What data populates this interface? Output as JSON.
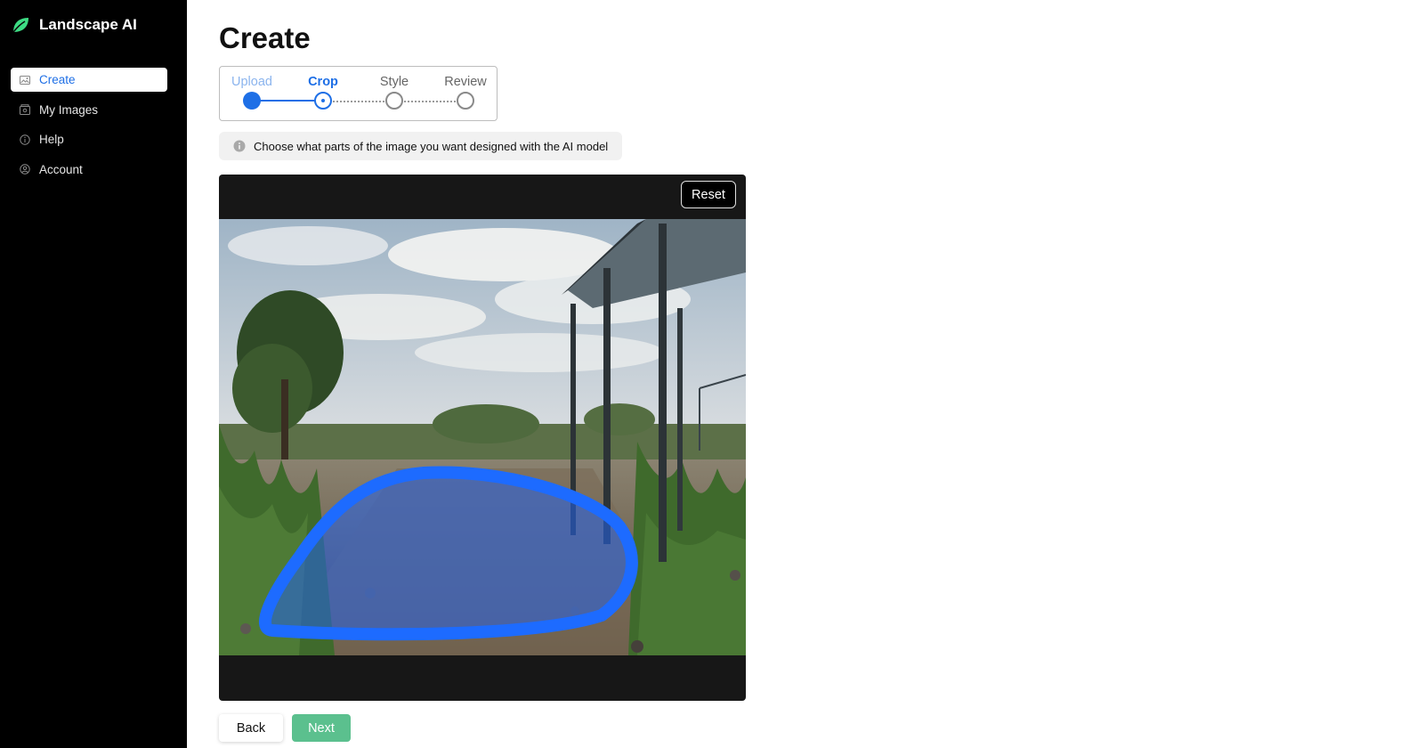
{
  "app": {
    "name": "Landscape AI",
    "accent": "#1e6fe6",
    "success": "#5bc08e"
  },
  "sidebar": {
    "items": [
      {
        "label": "Create",
        "icon": "image-icon",
        "active": true
      },
      {
        "label": "My Images",
        "icon": "gallery-icon",
        "active": false
      },
      {
        "label": "Help",
        "icon": "info-circle-icon",
        "active": false
      },
      {
        "label": "Account",
        "icon": "user-circle-icon",
        "active": false
      }
    ]
  },
  "page": {
    "title": "Create"
  },
  "stepper": {
    "steps": [
      {
        "label": "Upload",
        "state": "done"
      },
      {
        "label": "Crop",
        "state": "active"
      },
      {
        "label": "Style",
        "state": "todo"
      },
      {
        "label": "Review",
        "state": "todo"
      }
    ]
  },
  "info": {
    "text": "Choose what parts of the image you want designed with the AI model"
  },
  "editor": {
    "reset_label": "Reset"
  },
  "footer": {
    "back_label": "Back",
    "next_label": "Next"
  }
}
